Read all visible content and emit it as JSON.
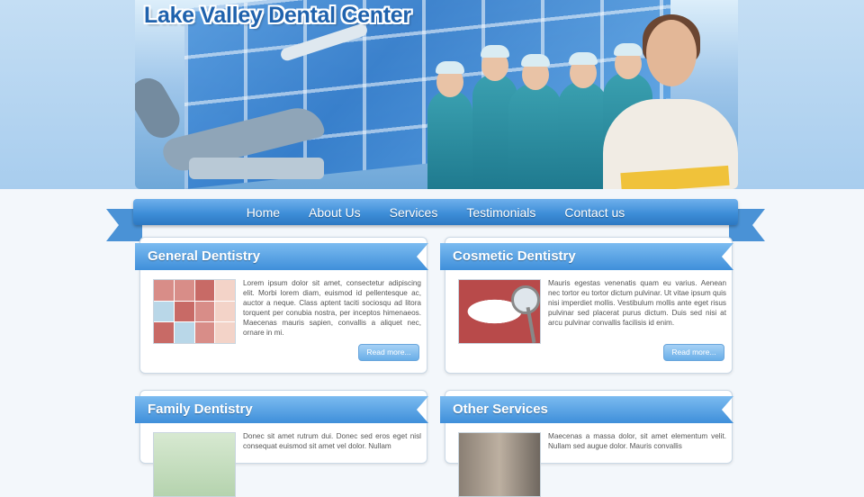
{
  "site": {
    "title": "Lake Valley Dental Center"
  },
  "nav": {
    "items": [
      "Home",
      "About Us",
      "Services",
      "Testimonials",
      "Contact us"
    ]
  },
  "panels": [
    {
      "heading": "General Dentistry",
      "text": "Lorem ipsum dolor sit amet, consectetur adipiscing elit. Morbi lorem diam, euismod id pellentesque ac, auctor a neque. Class aptent taciti sociosqu ad litora torquent per conubia nostra, per inceptos himenaeos. Maecenas mauris sapien, convallis a aliquet nec, ornare in mi.",
      "button": "Read more..."
    },
    {
      "heading": "Cosmetic Dentistry",
      "text": "Mauris egestas venenatis quam eu varius. Aenean nec tortor eu tortor dictum pulvinar. Ut vitae ipsum quis nisi imperdiet mollis. Vestibulum mollis ante eget risus pulvinar sed placerat purus dictum. Duis sed nisi at arcu pulvinar convallis facilisis id enim.",
      "button": "Read more..."
    },
    {
      "heading": "Family Dentistry",
      "text": "Donec sit amet rutrum dui. Donec sed eros eget nisl consequat euismod sit amet vel dolor. Nullam",
      "button": ""
    },
    {
      "heading": "Other Services",
      "text": "Maecenas a massa dolor, sit amet elementum velit. Nullam sed augue dolor. Mauris convallis",
      "button": ""
    }
  ]
}
